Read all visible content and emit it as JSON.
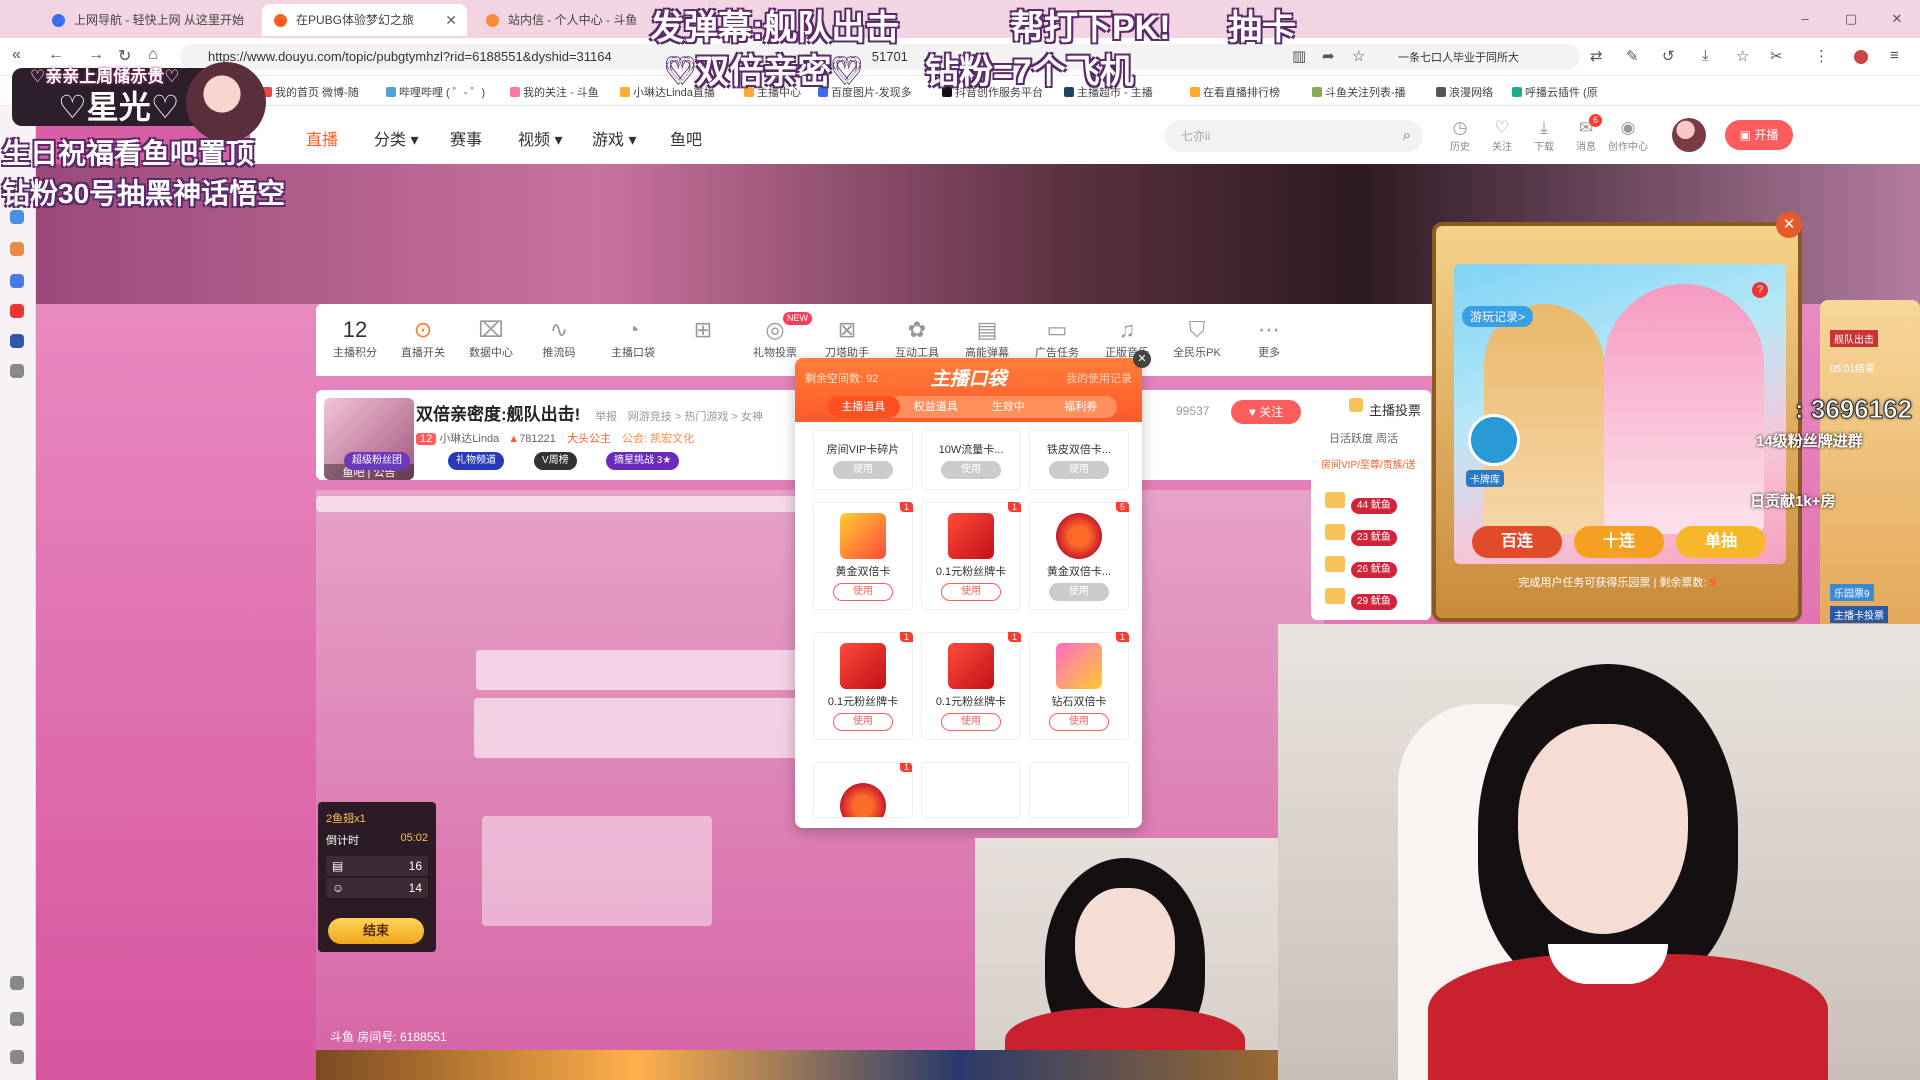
{
  "browser": {
    "tabs": [
      {
        "label": "上网导航 - 轻快上网 从这里开始",
        "active": false
      },
      {
        "label": "在PUBG体验梦幻之旅",
        "active": true
      },
      {
        "label": "站内信 - 个人中心 - 斗鱼",
        "active": false
      }
    ],
    "url": "https://www.douyu.com/topic/pubgtymhzl?rid=6188551&dyshid=31164",
    "url_tail": "51701",
    "search_hint": "一条七口人毕业于同所大",
    "bookmarks": [
      "我的首页 微博-随",
      "哔哩哔哩 ( ゜- ゜)",
      "我的关注 - 斗鱼",
      "小琳达Linda直播",
      "主播中心",
      "百度图片-发现多",
      "抖音创作服务平台",
      "主播超市 - 主播",
      "在看直播排行榜",
      "斗鱼关注列表-播",
      "浪漫网络",
      "呼播云插件 (原"
    ],
    "window_controls": [
      "–",
      "▢",
      "✕"
    ]
  },
  "site": {
    "nav": [
      "直播",
      "分类",
      "赛事",
      "视频",
      "游戏",
      "鱼吧"
    ],
    "search_placeholder": "七亦ii",
    "header_icons": [
      {
        "label": "历史",
        "icon": "history-icon"
      },
      {
        "label": "关注",
        "icon": "heart-icon"
      },
      {
        "label": "下载",
        "icon": "download-icon"
      },
      {
        "label": "消息",
        "icon": "message-icon",
        "badge": "6"
      },
      {
        "label": "创作中心",
        "icon": "bulb-icon"
      }
    ],
    "live_button": "开播"
  },
  "toolbar": {
    "score": "12",
    "score_label": "主播积分",
    "items": [
      "直播开关",
      "数据中心",
      "推流码",
      "主播口袋",
      "",
      "礼物投票",
      "刀塔助手",
      "互动工具",
      "高能弹幕",
      "广告任务",
      "正版音乐",
      "全民乐PK",
      "更多"
    ],
    "new_badge": "NEW"
  },
  "room": {
    "title": "双倍亲密度:舰队出击!",
    "report": "举报",
    "breadcrumb": "网游竞技 > 热门游戏 > 女神",
    "anchor_level": "12",
    "anchor": "小琳达Linda",
    "hot": "781221",
    "princess": "大头公主",
    "announcement": "公会: 凯宏文化",
    "follow_count": "99537",
    "follow": "关注",
    "thumb_label": "鱼吧 | 公告",
    "chips": [
      "超级粉丝团",
      "礼物频道",
      "V周榜",
      "摘星挑战 3★"
    ],
    "room_id": "斗鱼 房间号: 6188551"
  },
  "countdown": {
    "head": "2鱼翅x1",
    "label": "倒计时",
    "time": "05:02",
    "stat1": "16",
    "stat2": "14",
    "end": "结束"
  },
  "pocket": {
    "title": "主播口袋",
    "remaining": "剩余空间数: 92",
    "record": "我的使用记录",
    "tabs": [
      "主播道具",
      "权益道具",
      "生效中",
      "福利券"
    ],
    "top_items": [
      {
        "name": "房间VIP卡碎片",
        "use": "使用"
      },
      {
        "name": "10W流量卡...",
        "use": "使用"
      },
      {
        "name": "铁皮双倍卡...",
        "use": "使用"
      }
    ],
    "items": [
      {
        "name": "黄金双倍卡",
        "count": "1",
        "use": "使用",
        "kind": "gold",
        "enabled": true
      },
      {
        "name": "0.1元粉丝牌卡",
        "count": "1",
        "use": "使用",
        "kind": "red",
        "enabled": true
      },
      {
        "name": "黄金双倍卡...",
        "count": "5",
        "use": "使用",
        "kind": "puzzle",
        "enabled": false
      },
      {
        "name": "0.1元粉丝牌卡",
        "count": "1",
        "use": "使用",
        "kind": "red",
        "enabled": true
      },
      {
        "name": "0.1元粉丝牌卡",
        "count": "1",
        "use": "使用",
        "kind": "red",
        "enabled": true
      },
      {
        "name": "钻石双倍卡",
        "count": "1",
        "use": "使用",
        "kind": "diamond",
        "enabled": true
      },
      {
        "name": "",
        "count": "1",
        "use": "",
        "kind": "puzzle",
        "enabled": true
      }
    ]
  },
  "rank": {
    "title": "主播投票",
    "tabs": "日活跃度    周活",
    "sub": "房间VIP/至尊/贵族/送",
    "rows": [
      "44 鱿鱼",
      "23 鱿鱼",
      "26 鱿鱼",
      "29 鱿鱼"
    ]
  },
  "card_draw": {
    "record": "游玩记录>",
    "pool": "卡牌库",
    "buttons": [
      "百连",
      "十连",
      "单抽"
    ],
    "tip": "完成用户任务可获得乐园票 | 剩余票数: ",
    "tip_count": "9"
  },
  "fan": {
    "number": ": 3696162",
    "level_line": "14级粉丝牌进群",
    "day_line": "日贡献1k+房",
    "side_label": "舰队出击",
    "side_time": "05:01结束",
    "side_bottom": "乐园票9",
    "side_extra": "主播卡投票"
  },
  "overlay": {
    "top1": "发弹幕:舰队出击",
    "top2": "帮打下PK!",
    "top3": "抽卡",
    "line2a": "♡双倍亲密♡",
    "line2b": "钻粉=7个飞机",
    "left1": "生日祝福看鱼吧置顶",
    "left2": "钻粉30号抽黑神话悟空",
    "streamer_slogan": "♡亲亲上周储赤贵♡",
    "streamer_name": "♡星光♡"
  }
}
